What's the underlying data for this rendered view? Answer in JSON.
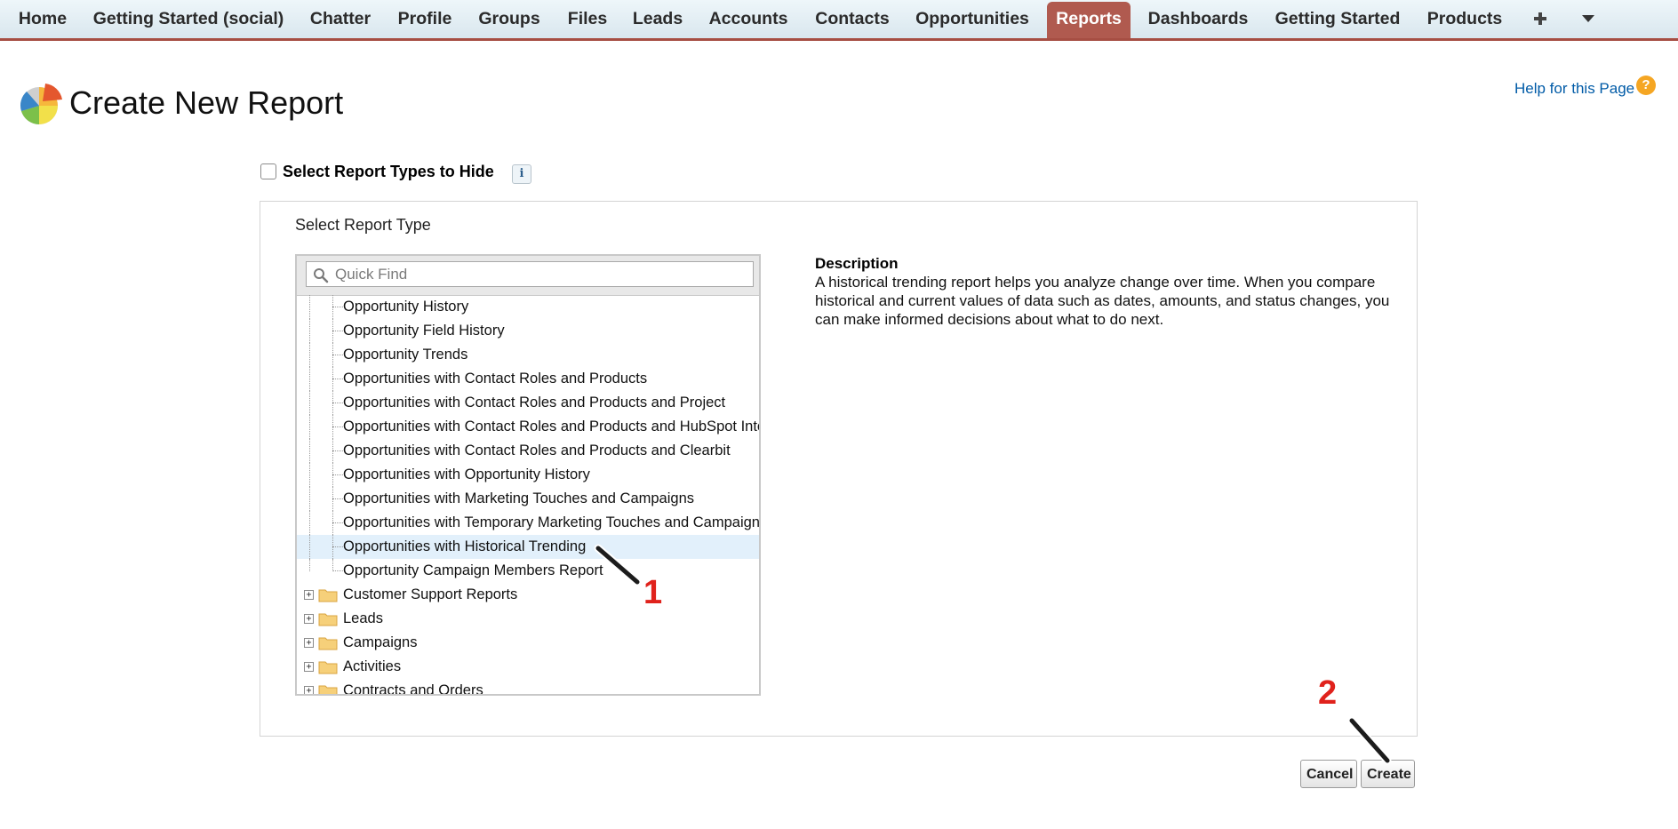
{
  "nav": {
    "tabs": [
      {
        "label": "Home"
      },
      {
        "label": "Getting Started (social)"
      },
      {
        "label": "Chatter"
      },
      {
        "label": "Profile"
      },
      {
        "label": "Groups"
      },
      {
        "label": "Files"
      },
      {
        "label": "Leads"
      },
      {
        "label": "Accounts"
      },
      {
        "label": "Contacts"
      },
      {
        "label": "Opportunities"
      },
      {
        "label": "Reports",
        "active": true
      },
      {
        "label": "Dashboards"
      },
      {
        "label": "Getting Started"
      },
      {
        "label": "Products"
      }
    ],
    "add_tab_icon": "plus-icon",
    "more_tabs_icon": "caret-down-icon",
    "active_color": "#b05a4f",
    "underline_color": "#a64e43"
  },
  "header": {
    "title": "Create New Report",
    "help_link": "Help for this Page",
    "help_icon": "?"
  },
  "hide_option": {
    "label": "Select Report Types to Hide",
    "checked": false,
    "info_icon": "i"
  },
  "selector": {
    "section_label": "Select Report Type",
    "search_placeholder": "Quick Find",
    "report_types": [
      {
        "label": "Opportunity History"
      },
      {
        "label": "Opportunity Field History"
      },
      {
        "label": "Opportunity Trends"
      },
      {
        "label": "Opportunities with Contact Roles and Products"
      },
      {
        "label": "Opportunities with Contact Roles and Products and Project"
      },
      {
        "label": "Opportunities with Contact Roles and Products and HubSpot Inte"
      },
      {
        "label": "Opportunities with Contact Roles and Products and Clearbit"
      },
      {
        "label": "Opportunities with Opportunity History"
      },
      {
        "label": "Opportunities with Marketing Touches and Campaigns"
      },
      {
        "label": "Opportunities with Temporary Marketing Touches and Campaign"
      },
      {
        "label": "Opportunities with Historical Trending",
        "selected": true
      },
      {
        "label": "Opportunity Campaign Members Report"
      }
    ],
    "folders": [
      {
        "label": "Customer Support Reports",
        "expander": "+"
      },
      {
        "label": "Leads",
        "expander": "+"
      },
      {
        "label": "Campaigns",
        "expander": "+"
      },
      {
        "label": "Activities",
        "expander": "+"
      },
      {
        "label": "Contracts and Orders",
        "expander": "+"
      }
    ],
    "selected_color": "#e2f0fb"
  },
  "description": {
    "title": "Description",
    "text": "A historical trending report helps you analyze change over time. When you compare historical and current values of data such as dates, amounts, and status changes, you can make informed decisions about what to do next."
  },
  "actions": {
    "cancel_label": "Cancel",
    "create_label": "Create"
  },
  "annotations": {
    "step1": "1",
    "step2": "2",
    "color": "#e0221c"
  }
}
